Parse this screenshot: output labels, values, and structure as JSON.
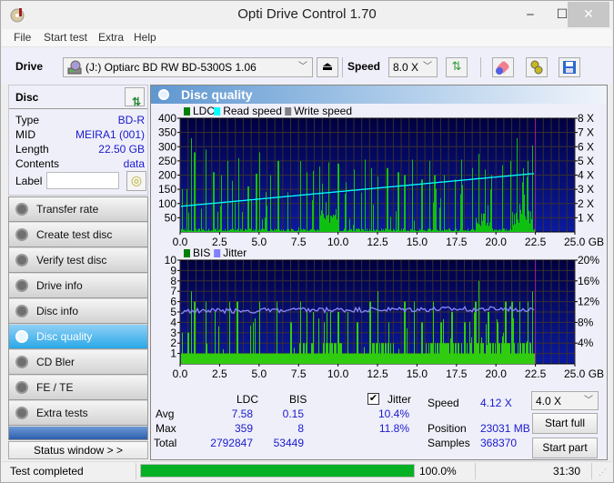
{
  "window": {
    "title": "Opti Drive Control 1.70",
    "controls": {
      "minimize": "‒",
      "maximize": "☐",
      "close": "✕"
    }
  },
  "menu": [
    "File",
    "Start test",
    "Extra",
    "Help"
  ],
  "toolbar": {
    "drive_label": "Drive",
    "drive_value": "(J:)   Optiarc BD RW BD-5300S 1.06",
    "speed_label": "Speed",
    "speed_value": "8.0 X",
    "icons": [
      "eject-icon",
      "refresh-icon",
      "erase-icon",
      "settings-icon",
      "save-icon"
    ]
  },
  "disc": {
    "header": "Disc",
    "fields": [
      {
        "key": "Type",
        "value": "BD-R"
      },
      {
        "key": "MID",
        "value": "MEIRA1 (001)"
      },
      {
        "key": "Length",
        "value": "22.50 GB"
      },
      {
        "key": "Contents",
        "value": "data"
      }
    ],
    "label_key": "Label",
    "label_value": ""
  },
  "nav": {
    "items": [
      "Transfer rate",
      "Create test disc",
      "Verify test disc",
      "Drive info",
      "Disc info",
      "Disc quality",
      "CD Bler",
      "FE / TE",
      "Extra tests"
    ],
    "active_index": 5,
    "status_window": "Status window > >"
  },
  "panel": {
    "title": "Disc quality"
  },
  "chart_data": [
    {
      "type": "bar",
      "title": "LDC",
      "legend": [
        {
          "name": "LDC",
          "color": "#008000"
        },
        {
          "name": "Read speed",
          "color": "#00ffff"
        },
        {
          "name": "Write speed",
          "color": "#808080"
        }
      ],
      "x_ticks": [
        "0.0",
        "2.5",
        "5.0",
        "7.5",
        "10.0",
        "12.5",
        "15.0",
        "17.5",
        "20.0",
        "22.5",
        "25.0 GB"
      ],
      "xlim": [
        0,
        25
      ],
      "y_ticks_left": [
        "400",
        "350",
        "300",
        "250",
        "200",
        "150",
        "100",
        "50"
      ],
      "ylim_left": [
        0,
        400
      ],
      "y_ticks_right": [
        "8 X",
        "7 X",
        "6 X",
        "5 X",
        "4 X",
        "3 X",
        "2 X",
        "1 X"
      ],
      "ylim_right": [
        0,
        8
      ],
      "data_end_gb": 22.5,
      "ldc_peaks": [
        [
          0.1,
          150
        ],
        [
          0.4,
          150
        ],
        [
          0.7,
          330
        ],
        [
          0.9,
          280
        ],
        [
          1.6,
          290
        ],
        [
          2.1,
          210
        ],
        [
          2.6,
          200
        ],
        [
          3.0,
          250
        ],
        [
          3.3,
          180
        ],
        [
          3.7,
          260
        ],
        [
          4.3,
          160
        ],
        [
          4.8,
          205
        ],
        [
          5.0,
          280
        ],
        [
          5.4,
          140
        ],
        [
          5.7,
          200
        ],
        [
          6.2,
          250
        ],
        [
          6.8,
          140
        ],
        [
          7.6,
          250
        ],
        [
          8.0,
          210
        ],
        [
          8.4,
          215
        ],
        [
          8.8,
          230
        ],
        [
          9.0,
          170
        ],
        [
          9.4,
          245
        ],
        [
          10.0,
          240
        ],
        [
          10.5,
          175
        ],
        [
          11.0,
          220
        ],
        [
          11.7,
          255
        ],
        [
          12.1,
          225
        ],
        [
          12.5,
          195
        ],
        [
          13.1,
          225
        ],
        [
          13.8,
          210
        ],
        [
          14.2,
          200
        ],
        [
          14.7,
          255
        ],
        [
          15.3,
          185
        ],
        [
          15.8,
          250
        ],
        [
          16.1,
          200
        ],
        [
          16.7,
          200
        ],
        [
          17.4,
          185
        ],
        [
          17.8,
          255
        ],
        [
          18.5,
          225
        ],
        [
          18.9,
          275
        ],
        [
          19.3,
          220
        ],
        [
          19.7,
          200
        ],
        [
          20.4,
          235
        ],
        [
          20.9,
          250
        ],
        [
          21.3,
          330
        ],
        [
          21.7,
          225
        ],
        [
          22.0,
          250
        ],
        [
          22.3,
          305
        ]
      ],
      "read_speed": {
        "start": 1.8,
        "end": 4.12
      }
    },
    {
      "type": "bar",
      "title": "BIS",
      "legend": [
        {
          "name": "BIS",
          "color": "#008000"
        },
        {
          "name": "Jitter",
          "color": "#8080ff"
        }
      ],
      "x_ticks": [
        "0.0",
        "2.5",
        "5.0",
        "7.5",
        "10.0",
        "12.5",
        "15.0",
        "17.5",
        "20.0",
        "22.5",
        "25.0 GB"
      ],
      "xlim": [
        0,
        25
      ],
      "y_ticks_left": [
        "10",
        "9",
        "8",
        "7",
        "6",
        "5",
        "4",
        "3",
        "2",
        "1"
      ],
      "ylim_left": [
        0,
        10
      ],
      "y_ticks_right": [
        "20%",
        "16%",
        "12%",
        "8%",
        "4%"
      ],
      "ylim_right": [
        0,
        20
      ],
      "data_end_gb": 22.5,
      "bis_peaks": [
        [
          0.1,
          3
        ],
        [
          0.5,
          3
        ],
        [
          0.7,
          7
        ],
        [
          0.9,
          6
        ],
        [
          1.6,
          6
        ],
        [
          2.2,
          5
        ],
        [
          3.1,
          6
        ],
        [
          3.6,
          6
        ],
        [
          4.6,
          4
        ],
        [
          5.0,
          6
        ],
        [
          6.1,
          6
        ],
        [
          7.0,
          4
        ],
        [
          7.6,
          6
        ],
        [
          8.0,
          5
        ],
        [
          8.4,
          5
        ],
        [
          9.1,
          4
        ],
        [
          9.5,
          5
        ],
        [
          10.0,
          5
        ],
        [
          10.6,
          5
        ],
        [
          11.2,
          4
        ],
        [
          12.0,
          6
        ],
        [
          12.5,
          7
        ],
        [
          13.2,
          4
        ],
        [
          14.2,
          6
        ],
        [
          14.8,
          6
        ],
        [
          15.3,
          4
        ],
        [
          16.0,
          6
        ],
        [
          16.5,
          4
        ],
        [
          17.2,
          5
        ],
        [
          18.0,
          4
        ],
        [
          18.7,
          6
        ],
        [
          18.9,
          8
        ],
        [
          19.5,
          5
        ],
        [
          20.1,
          4
        ],
        [
          20.6,
          6
        ],
        [
          21.0,
          6
        ],
        [
          21.5,
          6
        ],
        [
          22.0,
          6
        ],
        [
          22.3,
          7
        ]
      ],
      "jitter": {
        "start": 10.2,
        "end": 10.6,
        "avg": 10.4,
        "max": 11.8
      }
    }
  ],
  "stats": {
    "col_ldc": "LDC",
    "col_bis": "BIS",
    "jitter_label": "Jitter",
    "jitter_checked": true,
    "rows": [
      {
        "label": "Avg",
        "ldc": "7.58",
        "bis": "0.15",
        "jitter": "10.4%"
      },
      {
        "label": "Max",
        "ldc": "359",
        "bis": "8",
        "jitter": "11.8%"
      },
      {
        "label": "Total",
        "ldc": "2792847",
        "bis": "53449",
        "jitter": ""
      }
    ],
    "speed_label": "Speed",
    "speed_value": "4.12 X",
    "position_label": "Position",
    "position_value": "23031 MB",
    "samples_label": "Samples",
    "samples_value": "368370",
    "speed_select": "4.0 X",
    "start_full": "Start full",
    "start_part": "Start part"
  },
  "statusbar": {
    "message": "Test completed",
    "progress_percent": 100,
    "progress_text": "100.0%",
    "elapsed": "31:30"
  }
}
